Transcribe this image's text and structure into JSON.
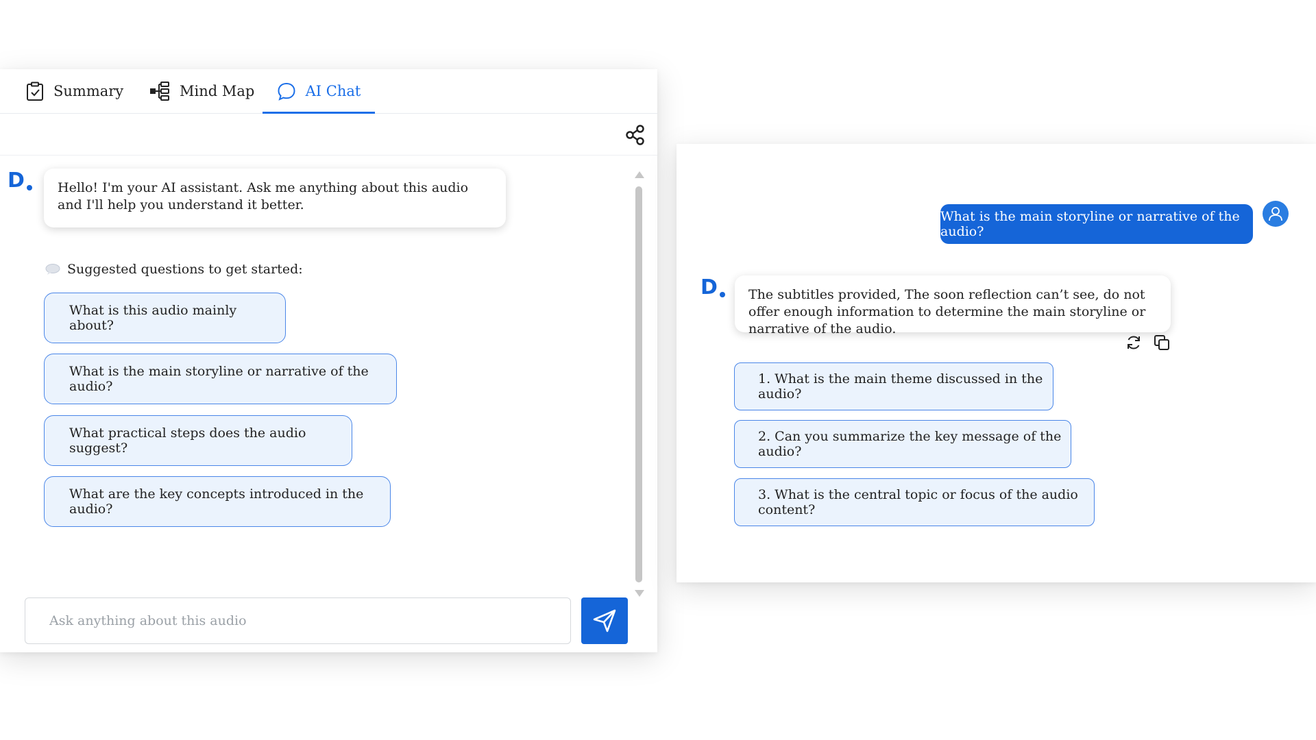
{
  "tabs": {
    "summary": "Summary",
    "mind_map": "Mind Map",
    "ai_chat": "AI Chat",
    "active": "AI Chat"
  },
  "left_chat": {
    "bot_logo_letter": "D",
    "greeting": "Hello! I'm your AI assistant. Ask me anything about this audio and I'll help you understand it better.",
    "suggested_title": "Suggested questions to get started:",
    "suggestions": [
      "What is this audio mainly about?",
      "What is the main storyline or narrative of the audio?",
      "What practical steps does the audio suggest?",
      "What are the key concepts introduced in the audio?"
    ],
    "input_placeholder": "Ask anything about this audio"
  },
  "right_chat": {
    "user_question": "What is the main storyline or narrative of the audio?",
    "bot_logo_letter": "D",
    "bot_answer": "The subtitles provided, The soon reflection can’t see, do not offer enough information to determine the main storyline or narrative of the audio.",
    "followups": [
      "1. What is the main theme discussed in the audio?",
      "2. Can you summarize the key message of the audio?",
      "3. What is the central topic or focus of the audio content?"
    ]
  },
  "icons": {
    "summary_tab": "clipboard-check-icon",
    "mindmap_tab": "mind-map-icon",
    "aichat_tab": "chat-bubble-icon",
    "share": "share-icon",
    "suggest": "speech-bubble-icon",
    "send": "send-icon",
    "user": "user-icon",
    "regenerate": "refresh-icon",
    "copy": "copy-icon"
  },
  "colors": {
    "accent": "#1565d8",
    "suggestion_bg": "#ebf3fd",
    "suggestion_border": "#4a86e8"
  }
}
